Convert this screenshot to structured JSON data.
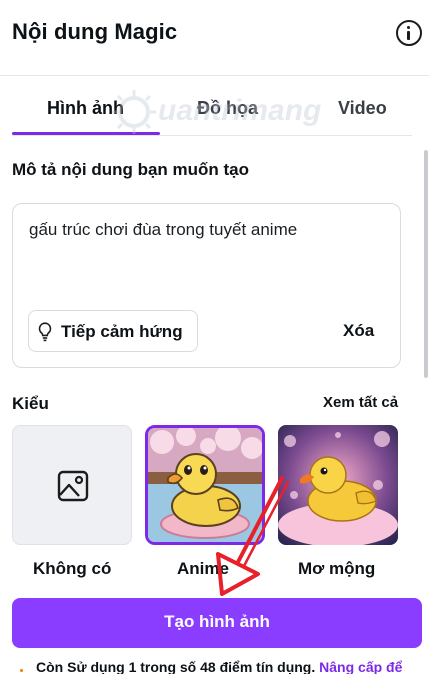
{
  "header": {
    "title": "Nội dung Magic"
  },
  "tabs": [
    {
      "label": "Hình ảnh",
      "active": true
    },
    {
      "label": "Đồ họa",
      "active": false
    },
    {
      "label": "Video",
      "active": false
    }
  ],
  "watermark": {
    "text": "uantrimang"
  },
  "prompt": {
    "label": "Mô tả nội dung bạn muốn tạo",
    "value": "gấu trúc chơi đùa trong tuyết anime",
    "inspire_label": "Tiếp cảm hứng",
    "clear_label": "Xóa"
  },
  "styles": {
    "label": "Kiểu",
    "see_all": "Xem tất cả",
    "items": [
      {
        "label": "Không có",
        "selected": false
      },
      {
        "label": "Anime",
        "selected": true
      },
      {
        "label": "Mơ mộng",
        "selected": false
      }
    ]
  },
  "generate": {
    "label": "Tạo hình ảnh"
  },
  "credits": {
    "text": "Còn Sử dụng 1 trong số 48 điểm tín dụng.",
    "upgrade": "Nâng cấp để"
  },
  "colors": {
    "accent": "#8b3dff",
    "tab_underline": "#7d2ae8",
    "annotation_arrow": "#e8202a"
  },
  "icons": [
    "info-icon",
    "lightbulb-icon",
    "image-icon"
  ]
}
